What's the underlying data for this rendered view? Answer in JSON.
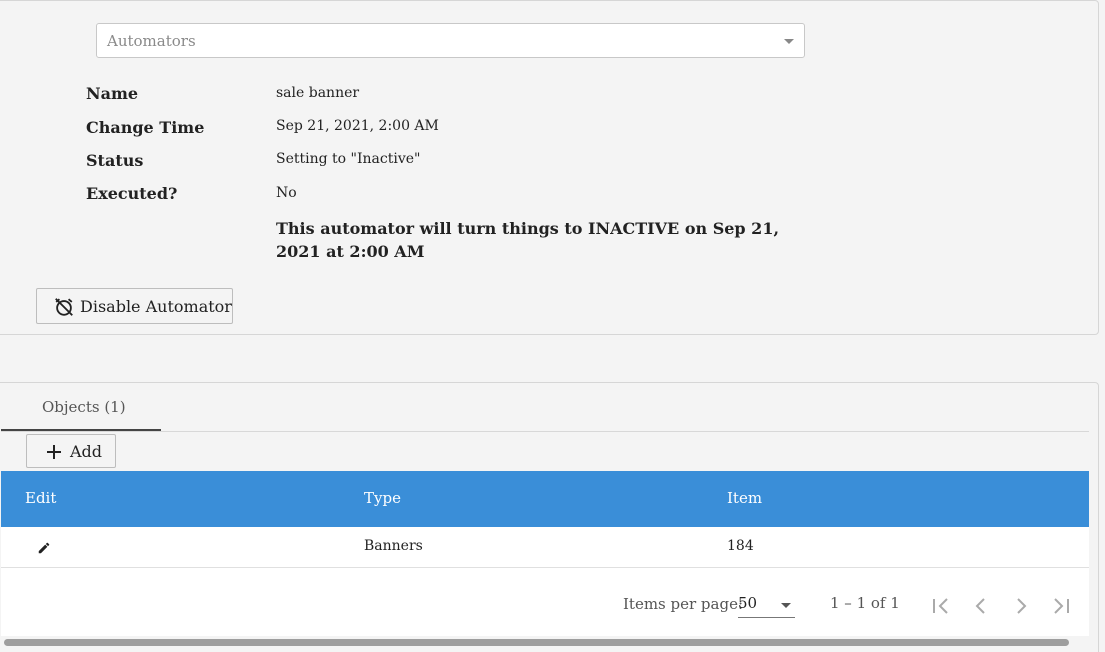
{
  "automator_select": {
    "placeholder": "Automators"
  },
  "details": {
    "name_label": "Name",
    "name_value": "sale banner",
    "change_time_label": "Change Time",
    "change_time_value": "Sep 21, 2021, 2:00 AM",
    "status_label": "Status",
    "status_value": "Setting to \"Inactive\"",
    "executed_label": "Executed?",
    "executed_value": "No",
    "notice": "This automator will turn things to INACTIVE on Sep 21, 2021 at 2:00 AM"
  },
  "disable_button": {
    "label": "Disable Automator",
    "icon": "alarm-off-icon"
  },
  "tabs": [
    {
      "label": "Objects (1)"
    }
  ],
  "add_button": {
    "label": "Add",
    "icon": "plus-icon"
  },
  "table": {
    "headers": [
      "Edit",
      "Type",
      "Item"
    ],
    "rows": [
      {
        "type": "Banners",
        "item": "184",
        "edit_icon": "pencil-icon"
      }
    ]
  },
  "paginator": {
    "items_per_page_label": "Items per page:",
    "items_per_page_value": "50",
    "range_label": "1 – 1 of 1"
  },
  "colors": {
    "table_header": "#3a8ed8",
    "background": "#f4f4f4"
  }
}
